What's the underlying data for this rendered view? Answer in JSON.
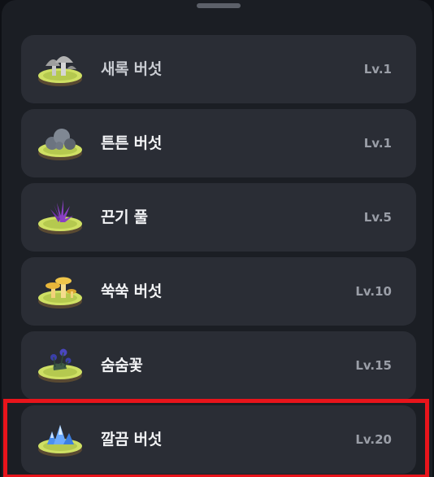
{
  "items": [
    {
      "name": "새록 버섯",
      "level": "Lv.1",
      "icon": "gray-mushroom-icon"
    },
    {
      "name": "튼튼 버섯",
      "level": "Lv.1",
      "icon": "stone-mushroom-icon"
    },
    {
      "name": "끈기 풀",
      "level": "Lv.5",
      "icon": "purple-grass-icon"
    },
    {
      "name": "쑥쑥 버섯",
      "level": "Lv.10",
      "icon": "yellow-mushroom-icon"
    },
    {
      "name": "숨숨꽃",
      "level": "Lv.15",
      "icon": "blue-flower-icon"
    },
    {
      "name": "깔끔 버섯",
      "level": "Lv.20",
      "icon": "blue-crystal-mushroom-icon"
    }
  ],
  "colors": {
    "background": "#1b1e24",
    "card": "#2a2d35",
    "highlight": "#e8141b",
    "island_grass": "#cfe064",
    "island_soil": "#5a4a32"
  }
}
